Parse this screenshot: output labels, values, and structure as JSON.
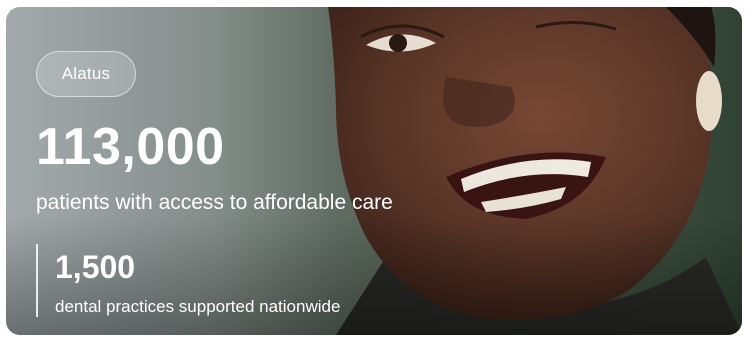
{
  "card": {
    "chip_label": "Alatus",
    "primary_stat": {
      "value": "113,000",
      "label": "patients with access to affordable care"
    },
    "secondary_stat": {
      "value": "1,500",
      "label": "dental practices supported nationwide"
    }
  },
  "colors": {
    "text": "#ffffff",
    "skin": "#5a3527",
    "background_green": "#3d4a3f"
  }
}
